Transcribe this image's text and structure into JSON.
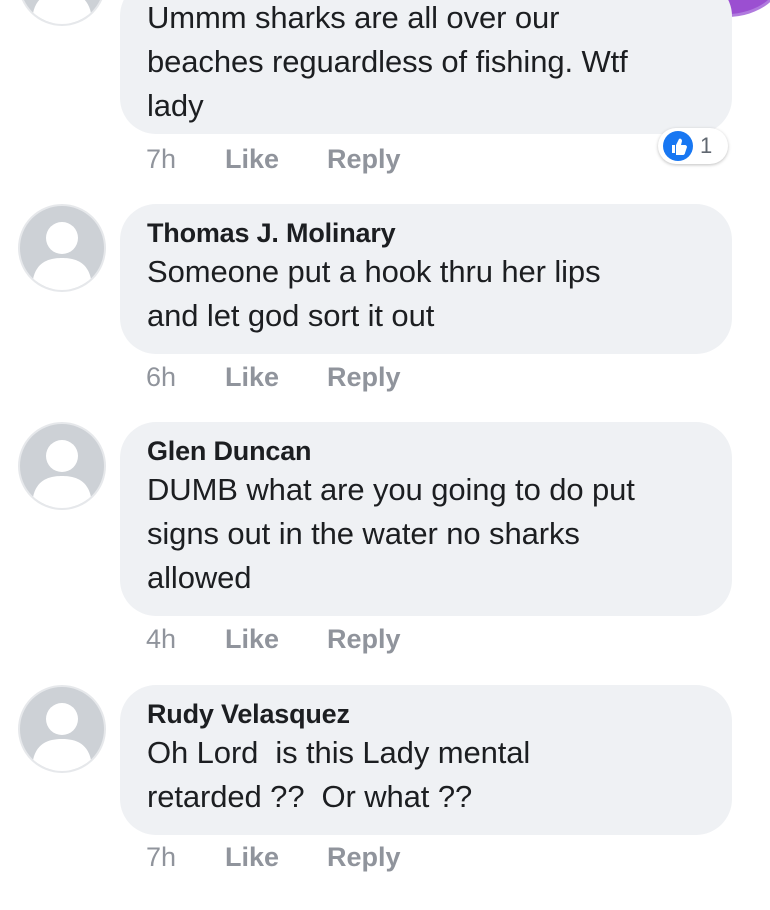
{
  "comments": [
    {
      "author": "",
      "text": "Ummm sharks are all over our\nbeaches reguardless of fishing. Wtf\nlady",
      "time": "7h",
      "like_label": "Like",
      "reply_label": "Reply",
      "reaction_count": "1"
    },
    {
      "author": "Thomas J. Molinary",
      "text": "Someone put a hook thru her lips\nand let god sort it out",
      "time": "6h",
      "like_label": "Like",
      "reply_label": "Reply"
    },
    {
      "author": "Glen Duncan",
      "text": "DUMB what are you going to do put\nsigns out in the water no sharks\nallowed",
      "time": "4h",
      "like_label": "Like",
      "reply_label": "Reply"
    },
    {
      "author": "Rudy Velasquez",
      "text": "Oh Lord  is this Lady mental\nretarded ??  Or what ??",
      "time": "7h",
      "like_label": "Like",
      "reply_label": "Reply"
    }
  ],
  "icons": {
    "avatar": "default-profile-icon",
    "reaction": "thumbs-up-icon",
    "corner": "messenger-chat-head"
  },
  "colors": {
    "bubble": "#eff1f4",
    "meta_text": "#90949c",
    "like_blue": "#1877f2",
    "chat_head_purple": "#9b4fd1"
  }
}
